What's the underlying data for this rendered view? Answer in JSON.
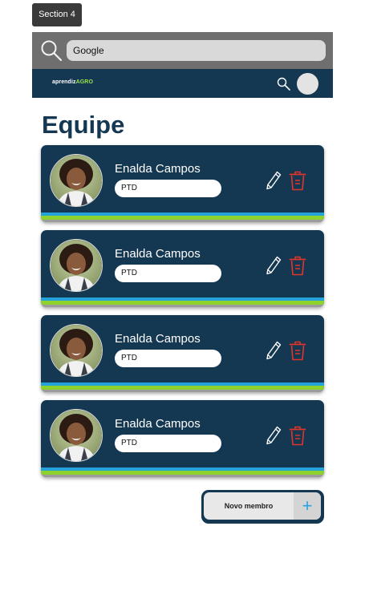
{
  "frame": {
    "section_label": "Section 4"
  },
  "browser": {
    "search_value": "Google"
  },
  "header": {
    "logo_main": "aprendiz",
    "logo_accent": "AGRO"
  },
  "page": {
    "title": "Equipe"
  },
  "members": [
    {
      "name": "Enalda Campos",
      "role": "PTD"
    },
    {
      "name": "Enalda Campos",
      "role": "PTD"
    },
    {
      "name": "Enalda Campos",
      "role": "PTD"
    },
    {
      "name": "Enalda Campos",
      "role": "PTD"
    }
  ],
  "actions": {
    "new_member_label": "Novo membro",
    "new_member_plus": "+"
  },
  "icons": {
    "search": "search-icon",
    "edit": "pencil-icon",
    "delete": "trash-icon",
    "avatar": "user-avatar"
  },
  "colors": {
    "primary": "#143752",
    "accent_green": "#8fd22e",
    "accent_blue": "#23a3d9",
    "delete_red": "#e0352b"
  }
}
